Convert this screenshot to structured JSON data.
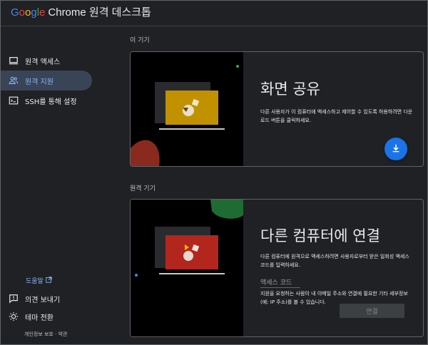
{
  "header": {
    "logo_letters": [
      "G",
      "o",
      "o",
      "g",
      "l",
      "e"
    ],
    "title_rest": "Chrome 원격 데스크톱"
  },
  "sidebar": {
    "items": [
      {
        "label": "원격 액세스",
        "icon": "laptop-icon"
      },
      {
        "label": "원격 지원",
        "icon": "people-icon"
      },
      {
        "label": "SSH를 통해 설정",
        "icon": "terminal-icon"
      }
    ],
    "help": {
      "label": "도움말",
      "icon": "open-in-new-icon"
    },
    "feedback": {
      "label": "의견 보내기",
      "icon": "feedback-icon"
    },
    "theme": {
      "label": "테마 전환",
      "icon": "sun-icon"
    },
    "footer": "개인정보 보호 · 약관"
  },
  "main": {
    "this_device_label": "이 기기",
    "remote_device_label": "원격 기기",
    "share_card": {
      "title": "화면 공유",
      "description": "다른 사용자가 이 컴퓨터에 액세스하고 제어할 수 있도록 허용하려면 다운로드 버튼을 클릭하세요.",
      "button_icon": "download-icon"
    },
    "connect_card": {
      "title": "다른 컴퓨터에 연결",
      "description": "다른 컴퓨터에 원격으로 액세스하려면 사용자로부터 받은 일회성 액세스 코드를 입력하세요.",
      "code_label": "액세스 코드",
      "code_help": "지원을 요청하는 사람이 내 이메일 주소와 연결에 필요한 기타 세부정보(예: IP 주소)를 볼 수 있습니다.",
      "connect_label": "연결"
    }
  },
  "colors": {
    "accent_blue": "#1a73e8",
    "active_nav_bg": "#394457",
    "link_blue": "#8ab4f8",
    "share_monitor": "#c29100",
    "connect_monitor": "#b3261e"
  }
}
